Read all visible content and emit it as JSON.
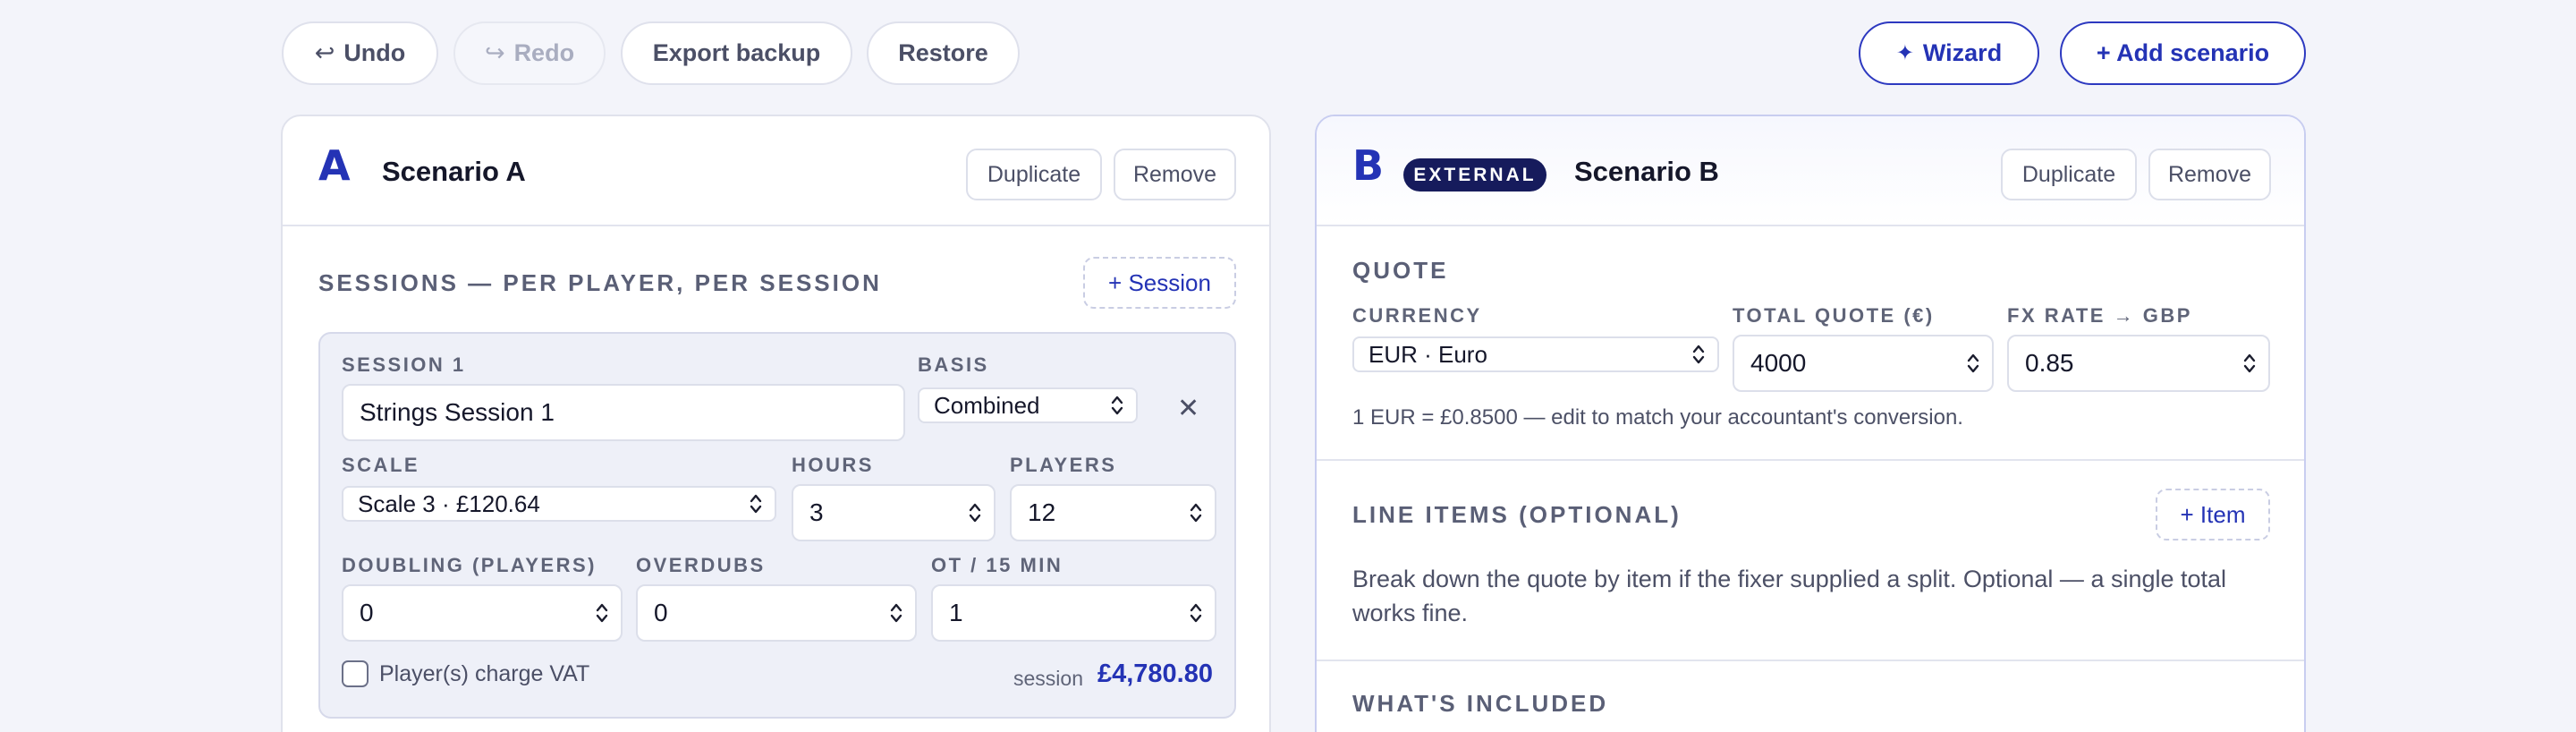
{
  "toolbar": {
    "undo": "Undo",
    "redo": "Redo",
    "export": "Export backup",
    "restore": "Restore",
    "wizard": "Wizard",
    "add_scenario": "+ Add scenario"
  },
  "scenario_a": {
    "letter": "A",
    "title": "Scenario A",
    "duplicate": "Duplicate",
    "remove": "Remove",
    "sessions_label": "SESSIONS — PER PLAYER, PER SESSION",
    "add_session": "+ Session",
    "session": {
      "name_label": "SESSION 1",
      "name_value": "Strings Session 1",
      "basis_label": "BASIS",
      "basis_value": "Combined",
      "scale_label": "SCALE",
      "scale_value": "Scale 3 · £120.64",
      "hours_label": "HOURS",
      "hours_value": "3",
      "players_label": "PLAYERS",
      "players_value": "12",
      "doubling_label": "DOUBLING (PLAYERS)",
      "doubling_value": "0",
      "overdubs_label": "OVERDUBS",
      "overdubs_value": "0",
      "ot_label": "OT / 15 MIN",
      "ot_value": "1",
      "vat_label": "Player(s) charge VAT",
      "vat_checked": false,
      "total_label": "session",
      "total_value": "£4,780.80"
    }
  },
  "scenario_b": {
    "letter": "B",
    "badge": "EXTERNAL",
    "title": "Scenario B",
    "duplicate": "Duplicate",
    "remove": "Remove",
    "quote_label": "QUOTE",
    "currency_label": "CURRENCY",
    "currency_value": "EUR · Euro",
    "total_quote_label": "TOTAL QUOTE (€)",
    "total_quote_value": "4000",
    "fx_label": "FX RATE → GBP",
    "fx_value": "0.85",
    "fx_note": "1 EUR = £0.8500 — edit to match your accountant's conversion.",
    "line_items_label": "LINE ITEMS (OPTIONAL)",
    "add_item": "+ Item",
    "line_items_note": "Break down the quote by item if the fixer supplied a split. Optional — a single total works fine.",
    "included_label": "WHAT'S INCLUDED"
  },
  "colors": {
    "accent": "#2433b5",
    "badge_bg": "#161b5c",
    "page_bg": "#f3f4fa"
  }
}
